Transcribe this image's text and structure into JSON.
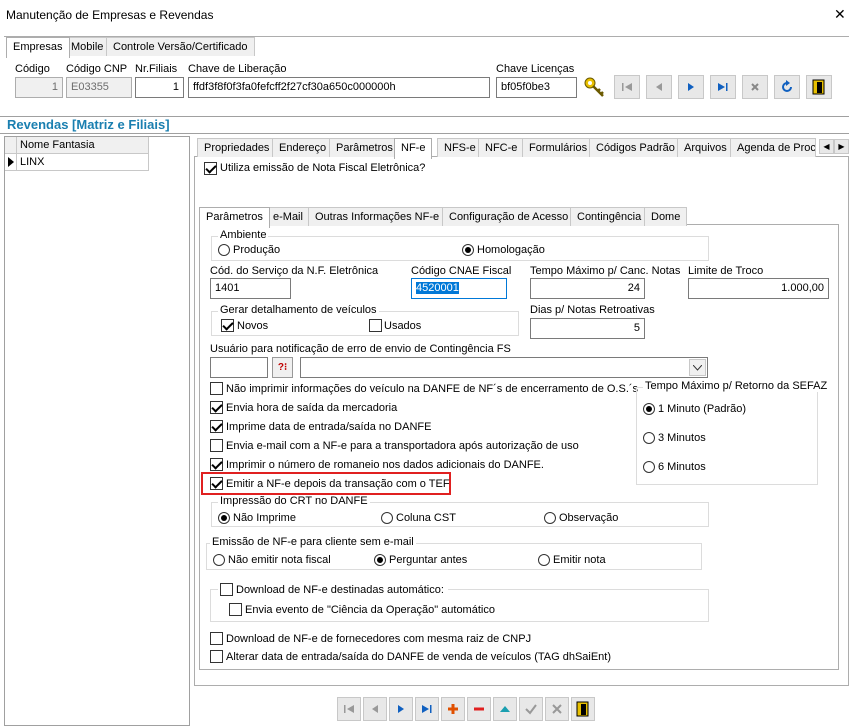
{
  "window": {
    "title": "Manutenção de Empresas e Revendas",
    "close": "✕"
  },
  "top_tabs": [
    "Empresas",
    "Mobile",
    "Controle Versão/Certificado"
  ],
  "header": {
    "codigo_label": "Código",
    "codigo_value": "1",
    "cnp_label": "Código CNP",
    "cnp_value": "E03355",
    "filiais_label": "Nr.Filiais",
    "filiais_value": "1",
    "chave_lib_label": "Chave de Liberação",
    "chave_lib_value": "ffdf3f8f0f3fa0fefcff2f27cf30a650c000000h",
    "chave_lic_label": "Chave Licenças",
    "chave_lic_value": "bf05f0be3"
  },
  "revendas": {
    "title": "Revendas [Matriz e Filiais]",
    "column": "Nome Fantasia",
    "rows": [
      "LINX"
    ]
  },
  "main_tabs": [
    "Propriedades",
    "Endereço",
    "Parâmetros",
    "NF-e",
    "NFS-e",
    "NFC-e",
    "Formulários",
    "Códigos Padrão",
    "Arquivos",
    "Agenda de Proces"
  ],
  "utiliza_nfe": "Utiliza emissão de Nota Fiscal Eletrônica?",
  "sub_tabs": [
    "Parâmetros",
    "e-Mail",
    "Outras Informações NF-e",
    "Configuração de Acesso",
    "Contingência",
    "Dome"
  ],
  "ambiente": {
    "title": "Ambiente",
    "producao": "Produção",
    "homologacao": "Homologação"
  },
  "fields": {
    "cod_servico_label": "Cód. do Serviço da N.F. Eletrônica",
    "cod_servico_value": "1401",
    "cnae_label": "Código CNAE Fiscal",
    "cnae_value": "4520001",
    "tempo_canc_label": "Tempo Máximo p/ Canc. Notas",
    "tempo_canc_value": "24",
    "limite_troco_label": "Limite de Troco",
    "limite_troco_value": "1.000,00",
    "dias_retro_label": "Dias p/ Notas Retroativas",
    "dias_retro_value": "5",
    "usuario_label": "Usuário para notificação de erro de envio de Contingência FS"
  },
  "veiculos": {
    "title": "Gerar detalhamento de veículos",
    "novos": "Novos",
    "usados": "Usados"
  },
  "checks": [
    "Não imprimir informações do veículo na DANFE de NF´s de encerramento de O.S.´s",
    "Envia hora de saída da mercadoria",
    "Imprime data de entrada/saída no DANFE",
    "Envia e-mail com a NF-e para a transportadora após autorização de uso",
    "Imprimir o número de romaneio nos dados adicionais do DANFE.",
    "Emitir a NF-e depois da transação com o TEF"
  ],
  "sefaz": {
    "title": "Tempo Máximo p/ Retorno da SEFAZ",
    "opts": [
      "1 Minuto (Padrão)",
      "3 Minutos",
      "6 Minutos"
    ]
  },
  "crt": {
    "title": "Impressão do CRT no DANFE",
    "opts": [
      "Não Imprime",
      "Coluna CST",
      "Observação"
    ]
  },
  "email": {
    "title": "Emissão de NF-e para cliente sem e-mail",
    "opts": [
      "Não emitir nota fiscal",
      "Perguntar antes",
      "Emitir nota"
    ]
  },
  "download": {
    "main": "Download de NF-e destinadas automático:",
    "evento": "Envia evento de \"Ciência da Operação\" automático"
  },
  "bottom_checks": [
    "Download de NF-e de fornecedores com mesma raiz de CNPJ",
    "Alterar data de entrada/saída do DANFE de venda de veículos (TAG dhSaiEnt)"
  ],
  "colors": {
    "accent": "#1a7fb0",
    "highlight": "#e02020",
    "selection": "#0078d7"
  }
}
